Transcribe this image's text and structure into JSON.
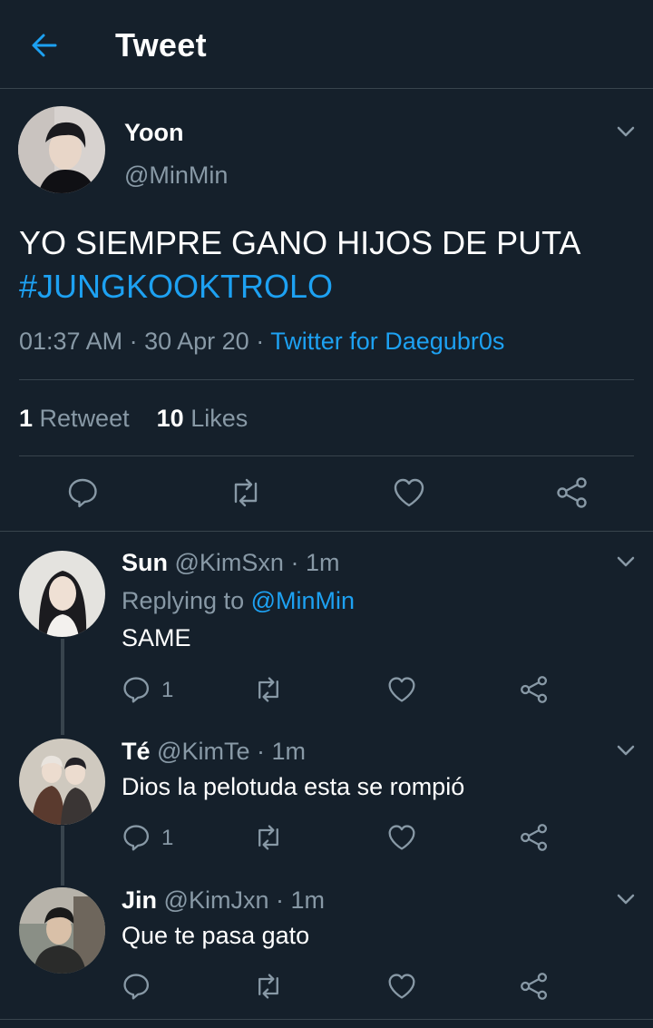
{
  "colors": {
    "background": "#15202b",
    "accent": "#1da1f2",
    "muted": "#8899a6",
    "border": "#38444d"
  },
  "header": {
    "title": "Tweet",
    "back_icon": "arrow-left-icon"
  },
  "tweet": {
    "name": "Yoon",
    "handle": "@MinMin",
    "text": "YO SIEMPRE GANO HIJOS DE PUTA",
    "hashtag": "#JUNGKOOKTROLO",
    "time": "01:37 AM",
    "date": "30 Apr 20",
    "sep": "·",
    "source": "Twitter for Daegubr0s",
    "retweet_count": "1",
    "retweet_label": "Retweet",
    "like_count": "10",
    "like_label": "Likes"
  },
  "replies": [
    {
      "name": "Sun",
      "handle": "@KimSxn",
      "dot": "·",
      "time": "1m",
      "replying_label": "Replying to",
      "replying_to": "@MinMin",
      "text": "SAME",
      "reply_count": "1"
    },
    {
      "name": "Té",
      "handle": "@KimTe",
      "dot": "·",
      "time": "1m",
      "text": "Dios la pelotuda esta se rompió",
      "reply_count": "1"
    },
    {
      "name": "Jin",
      "handle": "@KimJxn",
      "dot": "·",
      "time": "1m",
      "text": "Que te pasa gato",
      "reply_count": ""
    }
  ]
}
